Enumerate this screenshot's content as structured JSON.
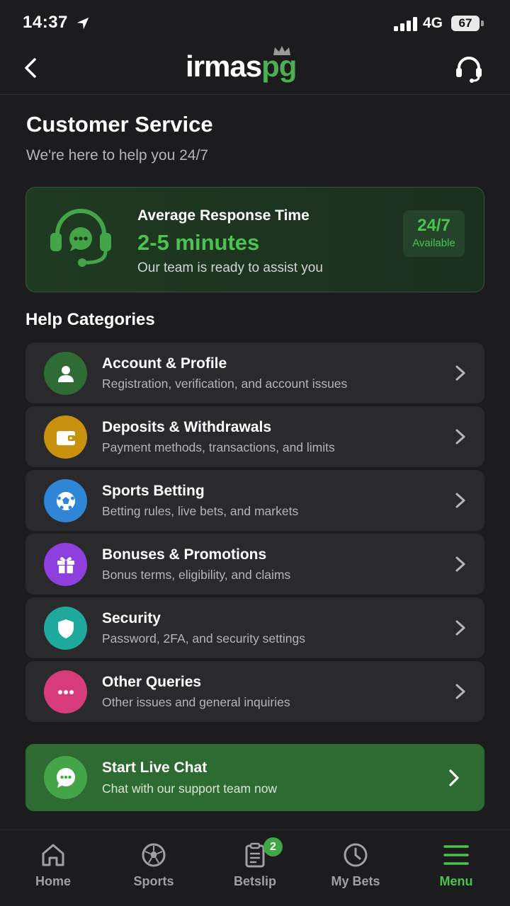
{
  "status_bar": {
    "time": "14:37",
    "network": "4G",
    "battery": "67"
  },
  "header": {
    "logo_main": "irmas",
    "logo_accent": "pg"
  },
  "page": {
    "title": "Customer Service",
    "subtitle": "We're here to help you 24/7"
  },
  "response_card": {
    "label": "Average Response Time",
    "value": "2-5 minutes",
    "note": "Our team is ready to assist you",
    "badge_main": "24/7",
    "badge_sub": "Available"
  },
  "help": {
    "section_title": "Help Categories",
    "categories": [
      {
        "title": "Account & Profile",
        "description": "Registration, verification, and account issues",
        "icon": "user-icon",
        "color": "#2e6b35"
      },
      {
        "title": "Deposits & Withdrawals",
        "description": "Payment methods, transactions, and limits",
        "icon": "wallet-icon",
        "color": "#c8920f"
      },
      {
        "title": "Sports Betting",
        "description": "Betting rules, live bets, and markets",
        "icon": "soccer-ball-icon",
        "color": "#2f86d6"
      },
      {
        "title": "Bonuses & Promotions",
        "description": "Bonus terms, eligibility, and claims",
        "icon": "gift-icon",
        "color": "#8e3fdd"
      },
      {
        "title": "Security",
        "description": "Password, 2FA, and security settings",
        "icon": "shield-icon",
        "color": "#1fa89c"
      },
      {
        "title": "Other Queries",
        "description": "Other issues and general inquiries",
        "icon": "more-icon",
        "color": "#d83c7a"
      }
    ]
  },
  "live_chat": {
    "title": "Start Live Chat",
    "subtitle": "Chat with our support team now"
  },
  "bottom_nav": {
    "items": [
      {
        "label": "Home",
        "icon": "home-icon"
      },
      {
        "label": "Sports",
        "icon": "soccer-ball-icon"
      },
      {
        "label": "Betslip",
        "icon": "betslip-icon",
        "badge": "2"
      },
      {
        "label": "My Bets",
        "icon": "clock-icon"
      },
      {
        "label": "Menu",
        "icon": "menu-icon",
        "active": true
      }
    ]
  },
  "colors": {
    "accent_green": "#4cc24f",
    "background": "#1c1c1e",
    "card": "#2a2a2d"
  }
}
